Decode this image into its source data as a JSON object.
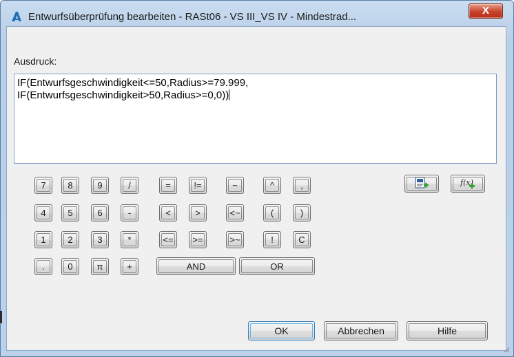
{
  "window": {
    "title": "Entwurfsüberprüfung bearbeiten - RASt06 - VS III_VS IV - Mindestrad...",
    "close_label": "X"
  },
  "expression": {
    "label": "Ausdruck:",
    "line1": "IF(Entwurfsgeschwindigkeit<=50,Radius>=79.999,",
    "line2": "IF(Entwurfsgeschwindigkeit>50,Radius>=0,0))"
  },
  "keypad": {
    "digits": [
      "7",
      "8",
      "9",
      "4",
      "5",
      "6",
      "1",
      "2",
      "3",
      ".",
      "0"
    ],
    "pi": "π",
    "div": "/",
    "minus": "-",
    "mul": "*",
    "plus": "+",
    "eq": "=",
    "neq": "!=",
    "tilde": "~",
    "caret": "^",
    "comma": ",",
    "lt": "<",
    "gt": ">",
    "lt_tilde": "<~",
    "lparen": "(",
    "rparen": ")",
    "le": "<=",
    "ge": ">=",
    "gt_tilde": ">~",
    "not": "!",
    "clear": "C",
    "and": "AND",
    "or": "OR"
  },
  "tools": {
    "insert_property_icon": "insert-property-icon",
    "insert_function_icon": "insert-function-icon",
    "function_glyph": "f(x)"
  },
  "dialog_buttons": {
    "ok": "OK",
    "cancel": "Abbrechen",
    "help": "Hilfe"
  }
}
